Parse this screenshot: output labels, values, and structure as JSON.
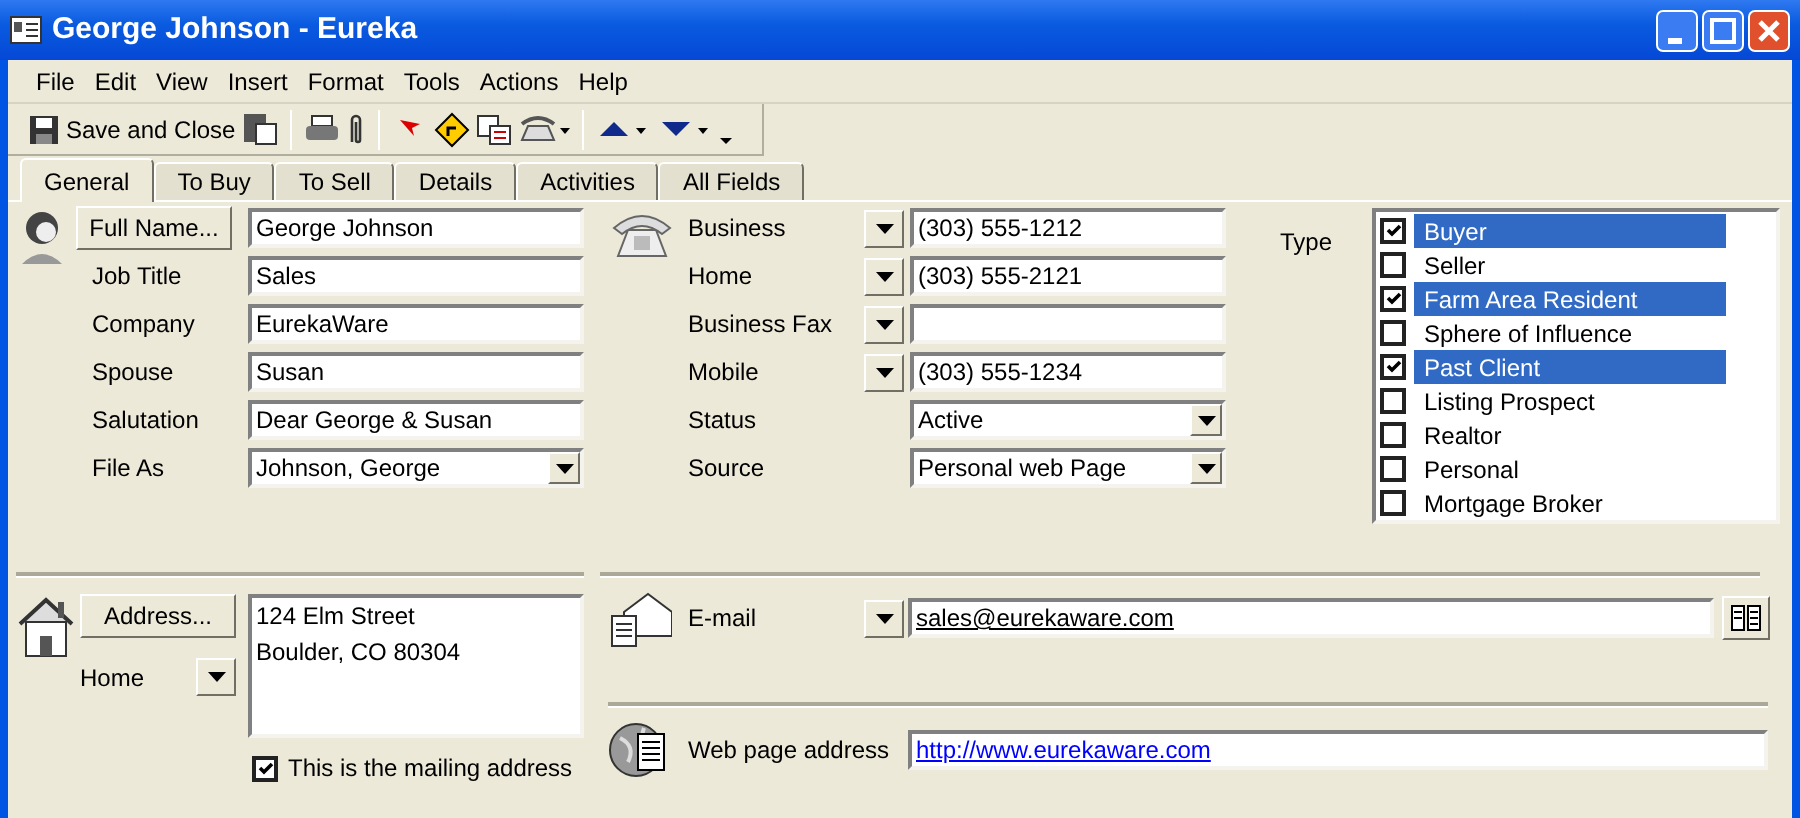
{
  "window": {
    "title": "George Johnson - Eureka"
  },
  "menu": [
    "File",
    "Edit",
    "View",
    "Insert",
    "Format",
    "Tools",
    "Actions",
    "Help"
  ],
  "toolbar": {
    "save_label": "Save and Close"
  },
  "tabs": [
    {
      "label": "General",
      "selected": true
    },
    {
      "label": "To Buy",
      "selected": false
    },
    {
      "label": "To Sell",
      "selected": false
    },
    {
      "label": "Details",
      "selected": false
    },
    {
      "label": "Activities",
      "selected": false
    },
    {
      "label": "All Fields",
      "selected": false
    }
  ],
  "name_fields": [
    {
      "kind": "button",
      "label": "Full Name...",
      "value": "George Johnson"
    },
    {
      "kind": "text",
      "label": "Job Title",
      "value": "Sales"
    },
    {
      "kind": "text",
      "label": "Company",
      "value": "EurekaWare"
    },
    {
      "kind": "text",
      "label": "Spouse",
      "value": "Susan"
    },
    {
      "kind": "text",
      "label": "Salutation",
      "value": "Dear George & Susan"
    },
    {
      "kind": "select",
      "label": "File As",
      "value": "Johnson, George"
    }
  ],
  "phone_fields": [
    {
      "kind": "phone",
      "label": "Business",
      "value": "(303) 555-1212"
    },
    {
      "kind": "phone",
      "label": "Home",
      "value": "(303) 555-2121"
    },
    {
      "kind": "phone",
      "label": "Business Fax"
    },
    {
      "kind": "phone",
      "label": "Mobile",
      "value": "(303) 555-1234"
    },
    {
      "kind": "select",
      "label": "Status",
      "value": "Active"
    },
    {
      "kind": "select",
      "label": "Source",
      "value": "Personal web Page"
    }
  ],
  "type": {
    "label": "Type",
    "items": [
      {
        "label": "Buyer",
        "checked": true,
        "selected": true
      },
      {
        "label": "Seller",
        "checked": false,
        "selected": false
      },
      {
        "label": "Farm Area Resident",
        "checked": true,
        "selected": true
      },
      {
        "label": "Sphere of Influence",
        "checked": false,
        "selected": false
      },
      {
        "label": "Past Client",
        "checked": true,
        "selected": true
      },
      {
        "label": "Listing Prospect",
        "checked": false,
        "selected": false
      },
      {
        "label": "Realtor",
        "checked": false,
        "selected": false
      },
      {
        "label": "Personal",
        "checked": false,
        "selected": false
      },
      {
        "label": "Mortgage Broker",
        "checked": false,
        "selected": false
      }
    ]
  },
  "address": {
    "button": "Address...",
    "kind_label": "Home",
    "lines": [
      "124 Elm Street",
      "Boulder, CO 80304"
    ],
    "mailing": {
      "label": "This is the mailing address",
      "checked": true
    }
  },
  "email": {
    "label": "E-mail",
    "value": "sales@eurekaware.com"
  },
  "web": {
    "label": "Web page address",
    "value": "http://www.eurekaware.com"
  }
}
